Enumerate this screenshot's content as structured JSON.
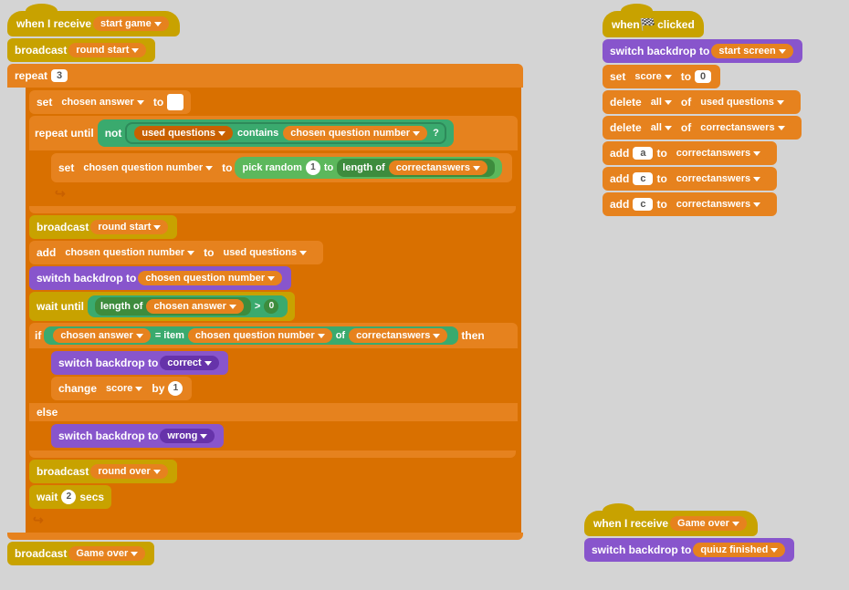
{
  "left_stack": {
    "event_receive": "when I receive",
    "receive_value": "start game",
    "broadcast1_label": "broadcast",
    "broadcast1_value": "round start",
    "repeat_label": "repeat",
    "repeat_value": "3",
    "set_label": "set",
    "set_var": "chosen answer",
    "set_to": "to",
    "repeat_until_label": "repeat until",
    "not_label": "not",
    "used_questions": "used questions",
    "contains_label": "contains",
    "chosen_question_number": "chosen question number",
    "set_label2": "set",
    "set_var2": "chosen question number",
    "to_label": "to",
    "pick_random_label": "pick random",
    "pick_random_1": "1",
    "to_label2": "to",
    "length_of_label": "length of",
    "correctanswers": "correctanswers",
    "broadcast2_label": "broadcast",
    "broadcast2_value": "round start",
    "add_label": "add",
    "chosen_qnum": "chosen question number",
    "to_label3": "to",
    "used_questions2": "used questions",
    "switch_backdrop_label": "switch backdrop to",
    "switch_backdrop_value": "chosen question number",
    "wait_until_label": "wait until",
    "length_of_label2": "length of",
    "chosen_answer2": "chosen answer",
    "gt_label": ">",
    "gt_value": "0",
    "if_label": "if",
    "chosen_answer3": "chosen answer",
    "eq_label": "=",
    "item_label": "item",
    "chosen_qnum2": "chosen question number",
    "of_label": "of",
    "correctanswers2": "correctanswers",
    "then_label": "then",
    "switch_correct_label": "switch backdrop to",
    "switch_correct_value": "correct",
    "change_label": "change",
    "score_var": "score",
    "by_label": "by",
    "by_value": "1",
    "else_label": "else",
    "switch_wrong_label": "switch backdrop to",
    "switch_wrong_value": "wrong",
    "broadcast3_label": "broadcast",
    "broadcast3_value": "round over",
    "wait_label": "wait",
    "wait_value": "2",
    "secs_label": "secs",
    "broadcast4_label": "broadcast",
    "broadcast4_value": "Game over"
  },
  "right_stack": {
    "event_clicked": "when",
    "clicked_label": "clicked",
    "switch_backdrop_label": "switch backdrop to",
    "switch_backdrop_value": "start screen",
    "set_score_label": "set",
    "score_var": "score",
    "to_label": "to",
    "score_value": "0",
    "delete1_label": "delete",
    "all1_label": "all",
    "of1_label": "of",
    "list1": "used questions",
    "delete2_label": "delete",
    "all2_label": "all",
    "of2_label": "of",
    "list2": "correctanswers",
    "add1_label": "add",
    "add1_value": "a",
    "to1_label": "to",
    "list3": "correctanswers",
    "add2_label": "add",
    "add2_value": "c",
    "to2_label": "to",
    "list4": "correctanswers",
    "add3_label": "add",
    "add3_value": "c",
    "to3_label": "to",
    "list5": "correctanswers"
  },
  "bottom_right_stack": {
    "event_receive": "when I receive",
    "receive_value": "Game over",
    "switch_label": "switch backdrop to",
    "switch_value": "quiuz finished"
  }
}
